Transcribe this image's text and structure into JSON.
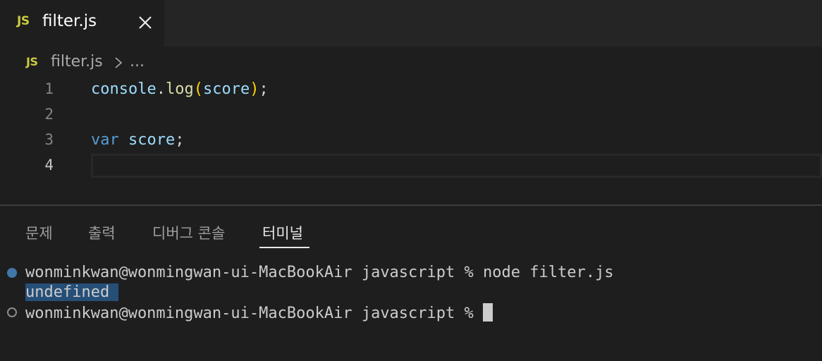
{
  "tab": {
    "badge": "JS",
    "filename": "filter.js",
    "close_icon": "close-icon"
  },
  "breadcrumb": {
    "badge": "JS",
    "file": "filter.js",
    "separator_icon": "chevron-right-icon",
    "ellipsis": "..."
  },
  "editor": {
    "lines": [
      {
        "number": "1",
        "tokens": [
          "console",
          ".",
          "log",
          "(",
          "score",
          ")",
          ";"
        ]
      },
      {
        "number": "2"
      },
      {
        "number": "3",
        "tokens": [
          "var",
          " ",
          "score",
          ";"
        ]
      },
      {
        "number": "4"
      }
    ]
  },
  "panel": {
    "tabs": [
      "문제",
      "출력",
      "디버그 콘솔",
      "터미널"
    ],
    "active_tab": "터미널"
  },
  "terminal": {
    "line1": "wonminkwan@wonmingwan-ui-MacBookAir javascript % node filter.js",
    "line2": "undefined ",
    "line3": "wonminkwan@wonmingwan-ui-MacBookAir javascript % "
  },
  "colors": {
    "background": "#1e1e1e",
    "js_badge": "#cbcb41",
    "keyword": "#569cd6",
    "variable": "#9cdcfe",
    "function": "#dcdcaa",
    "bracket": "#ffd700",
    "selection": "#264f78"
  }
}
